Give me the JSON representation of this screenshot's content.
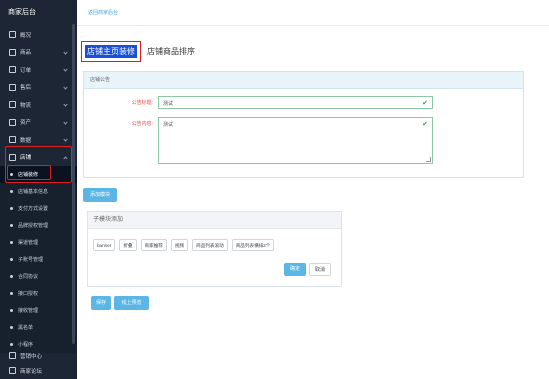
{
  "sidebar": {
    "brand": "商家后台",
    "items": [
      {
        "label": "概况"
      },
      {
        "label": "商品"
      },
      {
        "label": "订单"
      },
      {
        "label": "售后"
      },
      {
        "label": "物流"
      },
      {
        "label": "资产"
      },
      {
        "label": "数据"
      },
      {
        "label": "店铺"
      }
    ],
    "sub_items": [
      {
        "label": "店铺装修"
      },
      {
        "label": "店铺基本信息"
      },
      {
        "label": "支付方式设置"
      },
      {
        "label": "品牌授权管理"
      },
      {
        "label": "渠道管理"
      },
      {
        "label": "子账号管理"
      },
      {
        "label": "合同协议"
      },
      {
        "label": "接口授权"
      },
      {
        "label": "接收管理"
      },
      {
        "label": "黑名单"
      },
      {
        "label": "小程序"
      }
    ],
    "bottom_items": [
      {
        "label": "营销中心"
      },
      {
        "label": "商家论坛"
      }
    ]
  },
  "breadcrumb": "返回商家后台",
  "tabs": {
    "active": "店铺主页装修",
    "other": "店铺商品排序"
  },
  "notice_card": {
    "header": "店铺公告",
    "title_label": "公告标题:",
    "title_value": "测试",
    "content_label": "公告内容:",
    "content_value": "测试"
  },
  "add_module_button": "添加模块",
  "sub_module": {
    "header": "子模块添加",
    "chips": [
      "banner",
      "折叠",
      "商家推荐",
      "视频",
      "商品列表滚动",
      "商品列表横排2个"
    ],
    "confirm": "确定",
    "cancel": "取消"
  },
  "actions": {
    "save": "保存",
    "preview": "线上预览"
  },
  "colors": {
    "sidebar_bg": "#1d2635",
    "accent_blue": "#5bb6e6",
    "active_tab_bg": "#1a4fd6",
    "highlight_red": "#e02020",
    "valid_green": "#2fa84f"
  }
}
